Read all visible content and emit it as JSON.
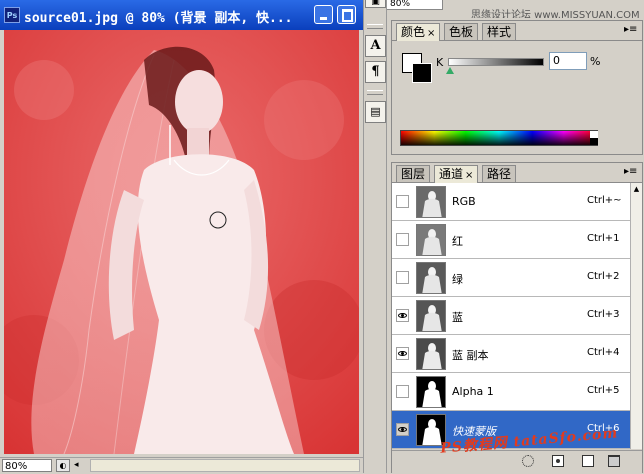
{
  "document": {
    "title": "source01.jpg @ 80% (背景 副本, 快...",
    "app_icon_text": "Ps",
    "status_zoom": "80%"
  },
  "top_strip": {
    "field_value": "80%",
    "watermark": "思缘设计论坛 www.MISSYUAN.COM"
  },
  "color_panel": {
    "tabs": [
      {
        "label": "颜色",
        "active": true,
        "closable": true
      },
      {
        "label": "色板",
        "active": false,
        "closable": false
      },
      {
        "label": "样式",
        "active": false,
        "closable": false
      }
    ],
    "close_glyph": "×",
    "menu_glyph": "▸≡",
    "channel_label": "K",
    "value": "0",
    "unit": "%",
    "fg_color": "#ffffff",
    "bg_color": "#000000"
  },
  "channels_panel": {
    "tabs": [
      {
        "label": "图层",
        "active": false,
        "closable": false
      },
      {
        "label": "通道",
        "active": true,
        "closable": true
      },
      {
        "label": "路径",
        "active": false,
        "closable": false
      }
    ],
    "close_glyph": "×",
    "menu_glyph": "▸≡",
    "channels": [
      {
        "name": "RGB",
        "shortcut": "Ctrl+~",
        "visible": false,
        "selected": false,
        "thumb": "photo"
      },
      {
        "name": "红",
        "shortcut": "Ctrl+1",
        "visible": false,
        "selected": false,
        "thumb": "photo"
      },
      {
        "name": "绿",
        "shortcut": "Ctrl+2",
        "visible": false,
        "selected": false,
        "thumb": "photo"
      },
      {
        "name": "蓝",
        "shortcut": "Ctrl+3",
        "visible": true,
        "selected": false,
        "thumb": "photo"
      },
      {
        "name": "蓝 副本",
        "shortcut": "Ctrl+4",
        "visible": true,
        "selected": false,
        "thumb": "photo"
      },
      {
        "name": "Alpha 1",
        "shortcut": "Ctrl+5",
        "visible": false,
        "selected": false,
        "thumb": "mask"
      },
      {
        "name": "快速蒙版",
        "shortcut": "Ctrl+6",
        "visible": true,
        "selected": true,
        "thumb": "mask"
      }
    ]
  },
  "overlay_watermark": "PS教程网 tataSfo.com",
  "colors": {
    "titlebar": "#0a3fbc",
    "selection": "#3168c6",
    "quickmask_red": "#e04545"
  }
}
